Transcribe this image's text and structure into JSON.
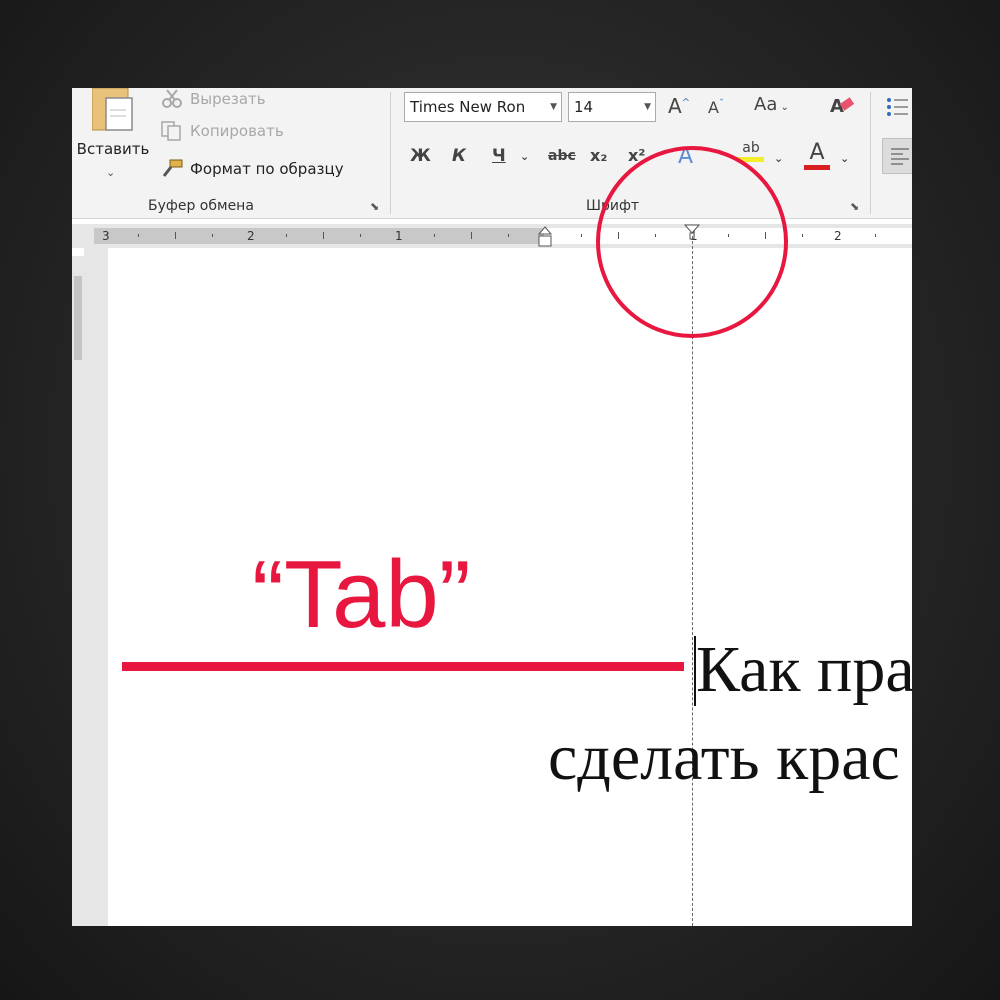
{
  "ribbon": {
    "clipboard": {
      "paste_label": "Вставить",
      "cut_label": "Вырезать",
      "copy_label": "Копировать",
      "format_painter_label": "Формат по образцу",
      "group_label": "Буфер обмена"
    },
    "font": {
      "font_name": "Times New Ron",
      "font_size": "14",
      "grow_icon": "A^",
      "shrink_icon": "Aˇ",
      "case_label": "Aa",
      "bold_label": "Ж",
      "italic_label": "К",
      "underline_label": "Ч",
      "strike_label": "abc",
      "subscript_label": "x₂",
      "superscript_label": "x²",
      "effects_label": "A",
      "highlight_label": "ab",
      "font_color_label": "A",
      "group_label": "Шрифт"
    }
  },
  "ruler": {
    "numbers": [
      "3",
      "2",
      "1",
      "1",
      "2"
    ]
  },
  "document": {
    "line1": "Как пра",
    "line2": "сделать крас"
  },
  "annotation": {
    "label": "“Tab”",
    "color": "#e8173f"
  }
}
